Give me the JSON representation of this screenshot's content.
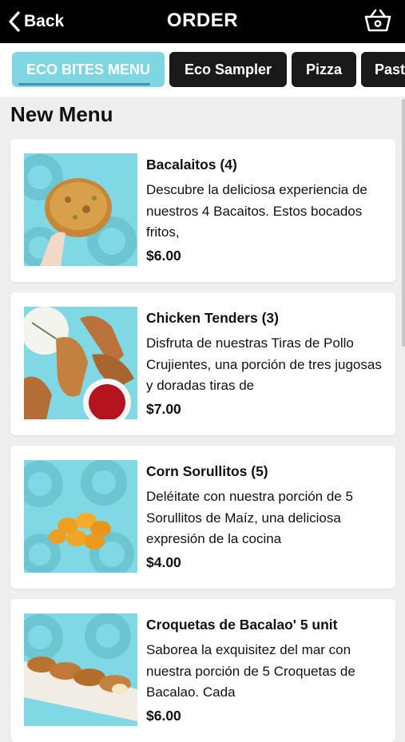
{
  "header": {
    "back_label": "Back",
    "title": "ORDER",
    "back_icon": "chevron-left-icon",
    "cart_icon": "basket-icon"
  },
  "tabs": [
    {
      "label": "ECO BITES MENU",
      "active": true
    },
    {
      "label": "Eco Sampler",
      "active": false
    },
    {
      "label": "Pizza",
      "active": false
    },
    {
      "label": "Past",
      "active": false
    }
  ],
  "section": {
    "title": "New Menu"
  },
  "items": [
    {
      "name": "Bacalaitos (4)",
      "description": "Descubre la deliciosa experiencia de nuestros 4 Bacaitos. Estos bocados fritos,",
      "price": "$6.00"
    },
    {
      "name": "Chicken Tenders (3)",
      "description": "Disfruta de nuestras Tiras de Pollo Crujientes, una porción de tres jugosas y doradas tiras de",
      "price": "$7.00"
    },
    {
      "name": "Corn Sorullitos (5)",
      "description": "Deléitate con nuestra porción de 5 Sorullitos de Maíz, una deliciosa expresión de la cocina",
      "price": "$4.00"
    },
    {
      "name": "Croquetas de Bacalao' 5 unit",
      "description": "Saborea la exquisitez del mar con nuestra porción de 5 Croquetas de Bacalao. Cada",
      "price": "$6.00"
    }
  ],
  "colors": {
    "header_bg": "#000000",
    "active_tab": "#7ed6e2",
    "tab_bg": "#1a1a1a",
    "page_bg": "#eeeeee",
    "image_bg": "#7fd8e4"
  }
}
